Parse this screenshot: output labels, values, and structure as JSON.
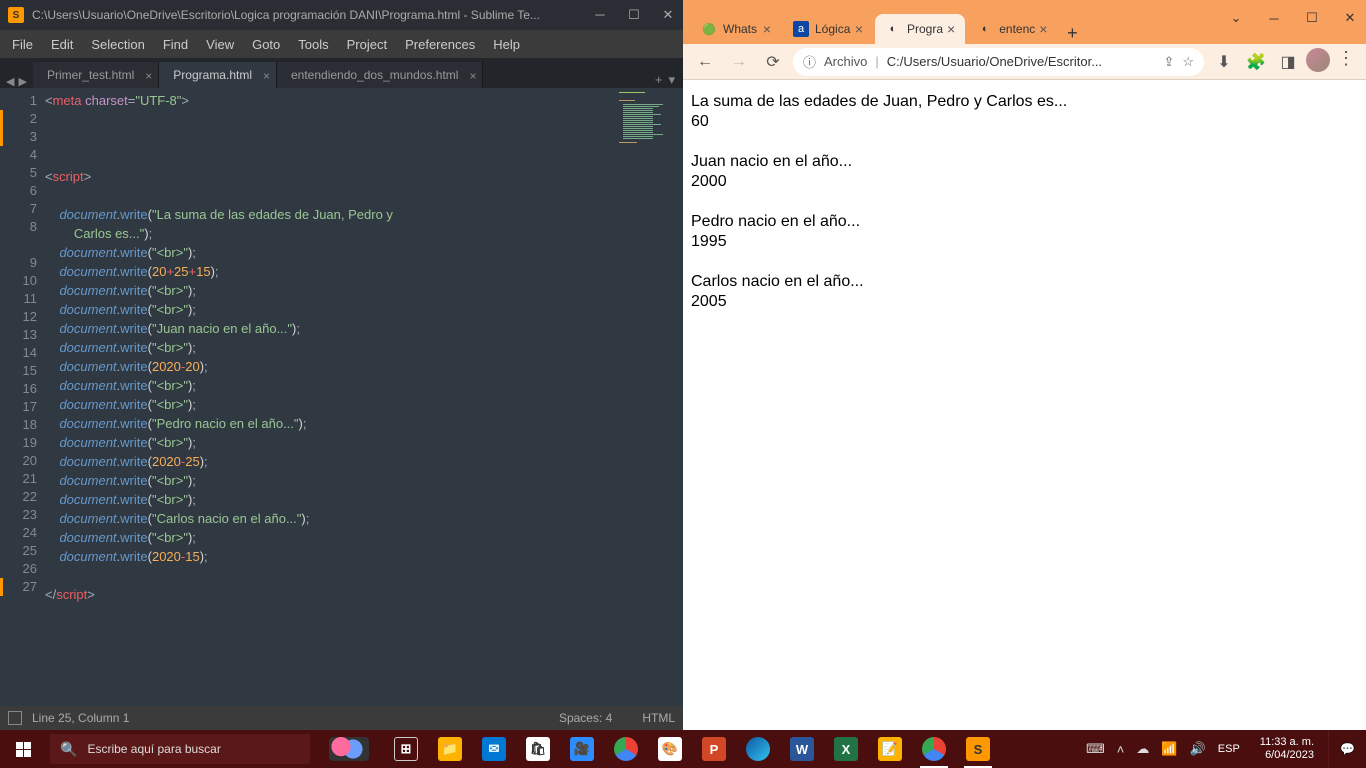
{
  "sublime": {
    "title": "C:\\Users\\Usuario\\OneDrive\\Escritorio\\Logica programación DANI\\Programa.html - Sublime Te...",
    "menu": [
      "File",
      "Edit",
      "Selection",
      "Find",
      "View",
      "Goto",
      "Tools",
      "Project",
      "Preferences",
      "Help"
    ],
    "tabs": [
      {
        "label": "Primer_test.html",
        "active": false
      },
      {
        "label": "Programa.html",
        "active": true
      },
      {
        "label": "entendiendo_dos_mundos.html",
        "active": false
      }
    ],
    "lines": [
      "1",
      "2",
      "3",
      "4",
      "5",
      "6",
      "7",
      "8",
      "9",
      "10",
      "11",
      "12",
      "13",
      "14",
      "15",
      "16",
      "17",
      "18",
      "19",
      "20",
      "21",
      "22",
      "23",
      "24",
      "25",
      "26",
      "27"
    ],
    "code": {
      "l1a": "<",
      "l1b": "meta ",
      "l1c": "charset",
      "l1d": "=",
      "l1e": "\"UTF-8\"",
      "l1f": ">",
      "l5a": "<",
      "l5b": "script",
      "l5c": ">",
      "l7a": "    ",
      "l7obj": "document",
      "l7dot": ".",
      "l7m": "write",
      "l7p1": "(",
      "l7s": "\"La suma de las edades de Juan, Pedro y \n        Carlos es...\"",
      "l7p2": ")",
      "l7sc": ";",
      "l8a": "    ",
      "l8obj": "document",
      "l8dot": ".",
      "l8m": "write",
      "l8p1": "(",
      "l8s": "\"<br>\"",
      "l8p2": ")",
      "l8sc": ";",
      "l9a": "    ",
      "l9obj": "document",
      "l9dot": ".",
      "l9m": "write",
      "l9p1": "(",
      "l9n1": "20",
      "l9op1": "+",
      "l9n2": "25",
      "l9op2": "+",
      "l9n3": "15",
      "l9p2": ")",
      "l9sc": ";",
      "l10a": "    ",
      "l10obj": "document",
      "l10dot": ".",
      "l10m": "write",
      "l10p1": "(",
      "l10s": "\"<br>\"",
      "l10p2": ")",
      "l10sc": ";",
      "l12a": "    ",
      "l12obj": "document",
      "l12dot": ".",
      "l12m": "write",
      "l12p1": "(",
      "l12s": "\"Juan nacio en el año...\"",
      "l12p2": ")",
      "l12sc": ";",
      "l14a": "    ",
      "l14obj": "document",
      "l14dot": ".",
      "l14m": "write",
      "l14p1": "(",
      "l14n1": "2020",
      "l14op": "-",
      "l14n2": "20",
      "l14p2": ")",
      "l14sc": ";",
      "l17a": "    ",
      "l17obj": "document",
      "l17dot": ".",
      "l17m": "write",
      "l17p1": "(",
      "l17s": "\"Pedro nacio en el año...\"",
      "l17p2": ")",
      "l17sc": ";",
      "l19a": "    ",
      "l19obj": "document",
      "l19dot": ".",
      "l19m": "write",
      "l19p1": "(",
      "l19n1": "2020",
      "l19op": "-",
      "l19n2": "25",
      "l19p2": ")",
      "l19sc": ";",
      "l22a": "    ",
      "l22obj": "document",
      "l22dot": ".",
      "l22m": "write",
      "l22p1": "(",
      "l22s": "\"Carlos nacio en el año...\"",
      "l22p2": ")",
      "l22sc": ";",
      "l24a": "    ",
      "l24obj": "document",
      "l24dot": ".",
      "l24m": "write",
      "l24p1": "(",
      "l24n1": "2020",
      "l24op": "-",
      "l24n2": "15",
      "l24p2": ")",
      "l24sc": ";",
      "l26a": "</",
      "l26b": "script",
      "l26c": ">"
    },
    "status": {
      "pos": "Line 25, Column 1",
      "spaces": "Spaces: 4",
      "lang": "HTML"
    }
  },
  "chrome": {
    "tabs": [
      {
        "fav": "🟢",
        "title": "Whats",
        "active": false
      },
      {
        "fav": "a",
        "title": "Lógica",
        "active": false,
        "favbg": "#0d47a1"
      },
      {
        "fav": "◐",
        "title": "Progra",
        "active": true
      },
      {
        "fav": "◐",
        "title": "entenc",
        "active": false
      }
    ],
    "toolbar": {
      "file_label": "Archivo",
      "url": "C:/Users/Usuario/OneDrive/Escritor..."
    },
    "content": {
      "p1": "La suma de las edades de Juan, Pedro y Carlos es...",
      "v1": "60",
      "p2": "Juan nacio en el año...",
      "v2": "2000",
      "p3": "Pedro nacio en el año...",
      "v3": "1995",
      "p4": "Carlos nacio en el año...",
      "v4": "2005"
    }
  },
  "taskbar": {
    "search_placeholder": "Escribe aquí para buscar",
    "tray": {
      "lang": "ESP",
      "time": "11:33 a. m.",
      "date": "6/04/2023"
    }
  }
}
